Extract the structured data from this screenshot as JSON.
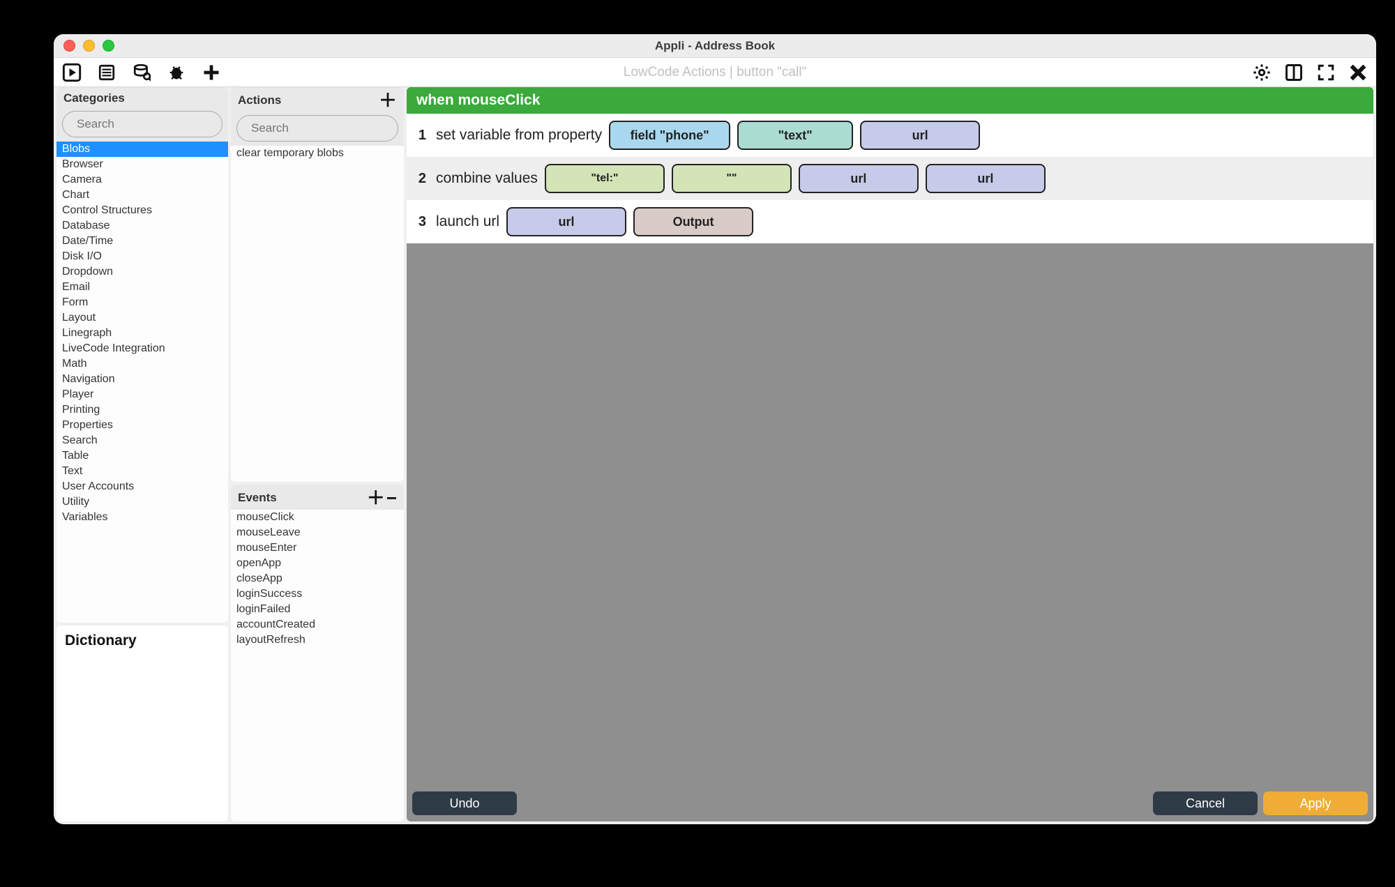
{
  "window": {
    "title": "Appli - Address Book"
  },
  "toolbar": {
    "subtitle": "LowCode Actions | button \"call\""
  },
  "categories": {
    "header": "Categories",
    "search_placeholder": "Search",
    "selected_index": 0,
    "items": [
      "Blobs",
      "Browser",
      "Camera",
      "Chart",
      "Control Structures",
      "Database",
      "Date/Time",
      "Disk I/O",
      "Dropdown",
      "Email",
      "Form",
      "Layout",
      "Linegraph",
      "LiveCode Integration",
      "Math",
      "Navigation",
      "Player",
      "Printing",
      "Properties",
      "Search",
      "Table",
      "Text",
      "User Accounts",
      "Utility",
      "Variables"
    ]
  },
  "actions": {
    "header": "Actions",
    "search_placeholder": "Search",
    "items": [
      "clear temporary blobs"
    ]
  },
  "events": {
    "header": "Events",
    "items": [
      "mouseClick",
      "mouseLeave",
      "mouseEnter",
      "openApp",
      "closeApp",
      "loginSuccess",
      "loginFailed",
      "accountCreated",
      "layoutRefresh"
    ]
  },
  "dictionary": {
    "header": "Dictionary"
  },
  "workflow": {
    "event_header": "when mouseClick",
    "steps": [
      {
        "n": "1",
        "label": "set variable from property",
        "chips": [
          {
            "text": "field \"phone\"",
            "cls": "blue"
          },
          {
            "text": "\"text\"",
            "cls": "teal"
          },
          {
            "text": "url",
            "cls": "violet"
          }
        ]
      },
      {
        "n": "2",
        "label": "combine values",
        "chips": [
          {
            "text": "\"tel:\"",
            "cls": "green"
          },
          {
            "text": "\"\"",
            "cls": "green"
          },
          {
            "text": "url",
            "cls": "violet"
          },
          {
            "text": "url",
            "cls": "violet"
          }
        ]
      },
      {
        "n": "3",
        "label": "launch url",
        "chips": [
          {
            "text": "url",
            "cls": "violet"
          },
          {
            "text": "Output",
            "cls": "tan"
          }
        ]
      }
    ]
  },
  "footer": {
    "undo": "Undo",
    "cancel": "Cancel",
    "apply": "Apply"
  }
}
